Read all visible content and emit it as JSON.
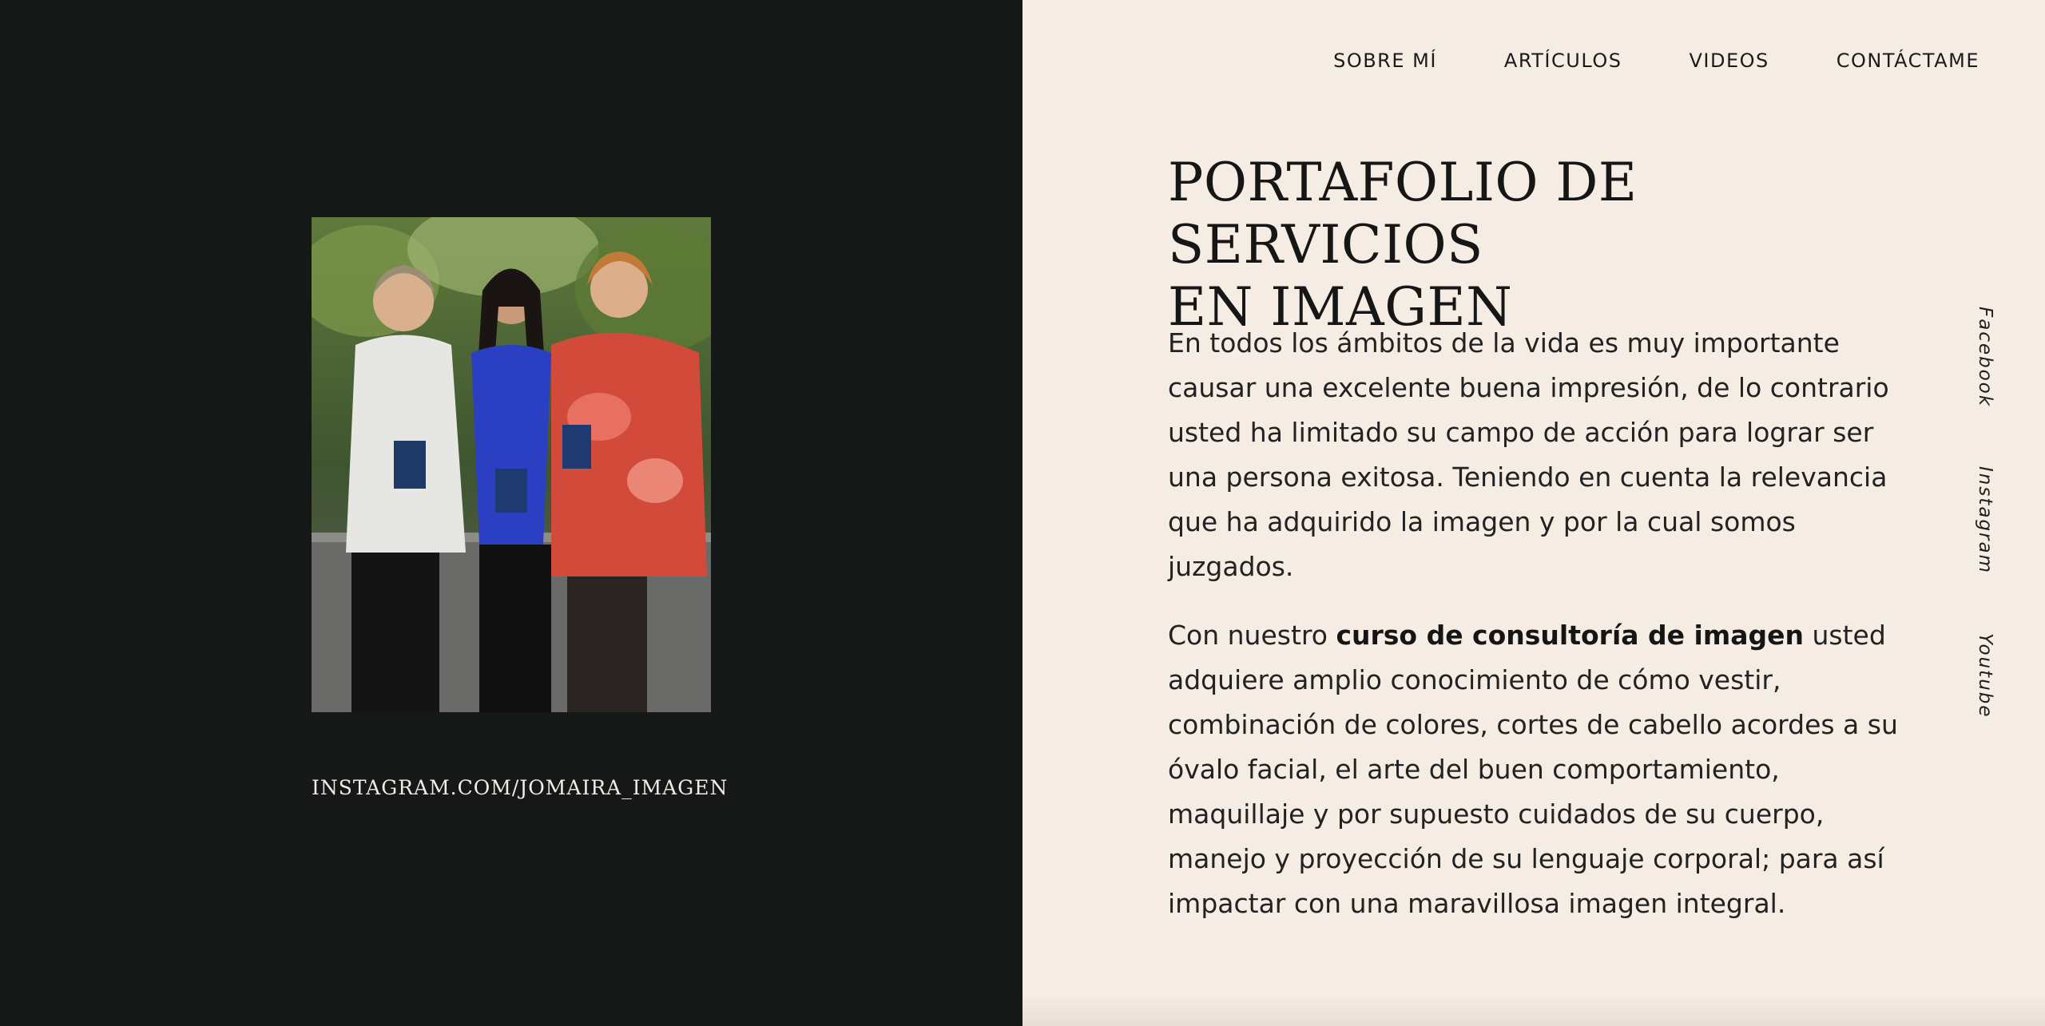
{
  "left": {
    "photo_alt": "Tres mujeres posando juntas",
    "instagram_link": "INSTAGRAM.COM/JOMAIRA_IMAGEN"
  },
  "nav": {
    "items": [
      {
        "label": "SOBRE MÍ"
      },
      {
        "label": "ARTÍCULOS"
      },
      {
        "label": "VIDEOS"
      },
      {
        "label": "CONTÁCTAME"
      }
    ]
  },
  "main": {
    "title_line1": "PORTAFOLIO DE SERVICIOS",
    "title_line2": "EN IMAGEN",
    "paragraph1": "En todos los ámbitos de la vida es muy importante causar una excelente buena impresión, de lo contrario usted ha limitado su campo de acción para lograr ser una persona exitosa. Teniendo en cuenta la relevancia que ha adquirido la imagen y por la cual somos juzgados.",
    "paragraph2_before": "Con nuestro ",
    "paragraph2_bold": "curso de consultoría de imagen",
    "paragraph2_after": " usted adquiere amplio conocimiento de cómo vestir, combinación de colores, cortes de cabello acordes a su óvalo facial, el arte del buen comportamiento, maquillaje y por supuesto cuidados de su cuerpo, manejo y proyección de su lenguaje corporal; para así impactar con una maravillosa imagen integral."
  },
  "social": {
    "items": [
      {
        "label": "Facebook"
      },
      {
        "label": "Instagram"
      },
      {
        "label": "Youtube"
      }
    ]
  },
  "colors": {
    "left_bg": "#161818",
    "right_bg": "#f5ece3",
    "text_dark": "#161616",
    "text_light": "#f1ece6"
  }
}
